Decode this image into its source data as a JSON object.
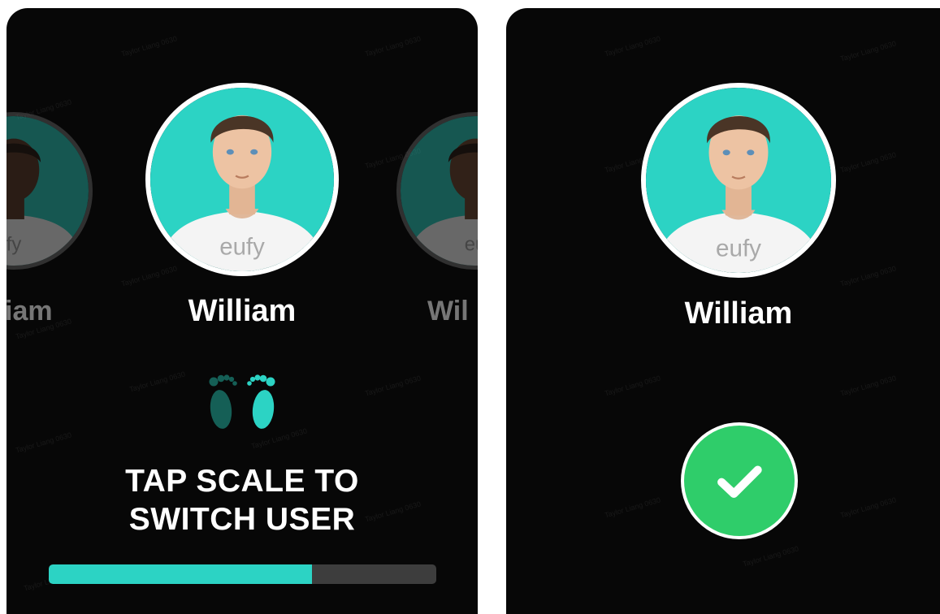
{
  "left_screen": {
    "current_user": {
      "name": "William",
      "shirt_logo": "eufy"
    },
    "prev_user": {
      "name_fragment": "iam",
      "shirt_logo_fragment": "fy"
    },
    "next_user": {
      "name_fragment": "Wil",
      "shirt_logo_fragment": "eu"
    },
    "feet_icon": "footprints-icon",
    "prompt_line1": "TAP SCALE TO",
    "prompt_line2": "SWITCH USER",
    "progress_fraction": 0.68
  },
  "right_screen": {
    "user": {
      "name": "William",
      "shirt_logo": "eufy"
    },
    "status_icon": "checkmark-icon"
  },
  "watermark_text": "Taylor Liang 0630",
  "colors": {
    "accent_teal": "#2cd3c4",
    "success_green": "#2fcd6a",
    "background": "#070707",
    "track_gray": "#3d3d3d",
    "foot_dark": "#155f56"
  }
}
